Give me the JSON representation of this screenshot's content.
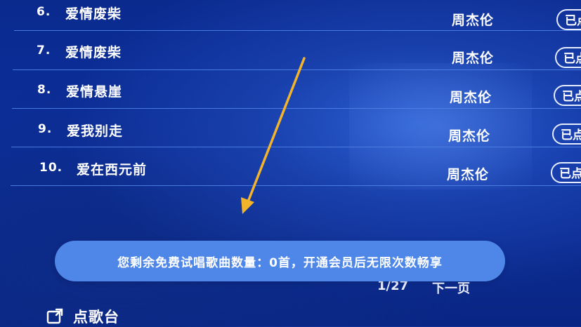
{
  "songs": [
    {
      "number": "6.",
      "title": "爱情废柴",
      "artist": "周杰伦",
      "status": "已点"
    },
    {
      "number": "7.",
      "title": "爱情废柴",
      "artist": "周杰伦",
      "status": "已点"
    },
    {
      "number": "8.",
      "title": "爱情悬崖",
      "artist": "周杰伦",
      "status": "已点"
    },
    {
      "number": "9.",
      "title": "爱我别走",
      "artist": "周杰伦",
      "status": "已点"
    },
    {
      "number": "10.",
      "title": "爱在西元前",
      "artist": "周杰伦",
      "status": "已点"
    }
  ],
  "toast": {
    "message": "您剩余免费试唱歌曲数量：0首，开通会员后无限次数畅享"
  },
  "pagination": {
    "page": "1/27",
    "next_label": "下一页"
  },
  "bottom_bar": {
    "label": "点歌台"
  },
  "colors": {
    "background": "#0b2f9c",
    "toast": "#4e87e8",
    "divider": "#4f82e6",
    "arrow": "#f3b32a"
  }
}
